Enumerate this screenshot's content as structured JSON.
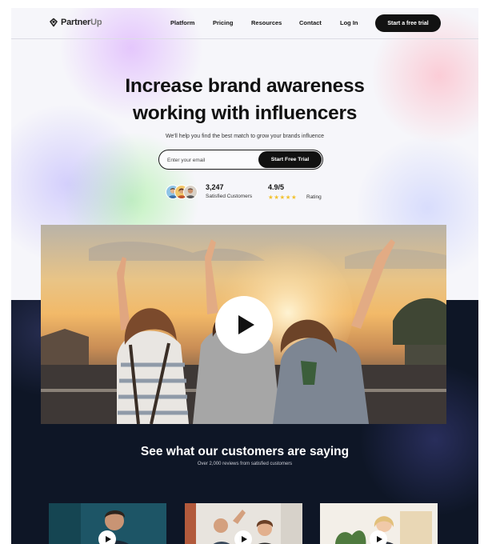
{
  "nav": {
    "logo_main": "Partner",
    "logo_accent": "Up",
    "links": [
      "Platform",
      "Pricing",
      "Resources",
      "Contact",
      "Log In"
    ],
    "cta": "Start a free trial"
  },
  "hero": {
    "title_line1": "Increase brand awareness",
    "title_line2": "working with influencers",
    "subtitle": "We'll help you find the best match to grow your brands influence",
    "email_placeholder": "Enter your email",
    "email_value": "",
    "button": "Start Free Trial",
    "customers_count": "3,247",
    "customers_label": "Satisfied Customers",
    "rating_value": "4.9/5",
    "rating_stars": 5,
    "rating_label": "Rating"
  },
  "video": {
    "play_icon": "play-icon"
  },
  "testimonials": {
    "title": "See what our customers are saying",
    "subtitle": "Over 2,000 reviews from satisfied customers",
    "cards": [
      {
        "play_icon": "play-icon"
      },
      {
        "play_icon": "play-icon"
      },
      {
        "play_icon": "play-icon"
      }
    ]
  },
  "colors": {
    "dark_bg": "#0e1626",
    "button_bg": "#121212",
    "star": "#f2c230"
  }
}
